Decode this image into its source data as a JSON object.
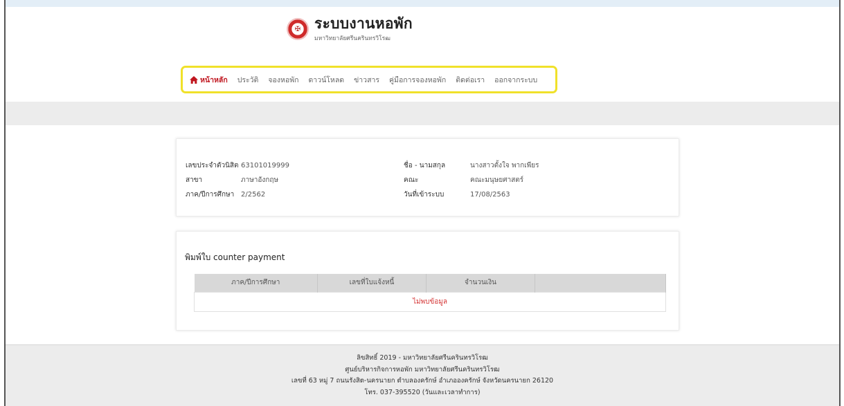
{
  "brand": {
    "seal_glyph": "✠",
    "title": "ระบบงานหอพัก",
    "subtitle": "มหาวิทยาลัยศรีนครินทรวิโรฒ"
  },
  "nav": {
    "items": [
      {
        "label": "หน้าหลัก",
        "active": true,
        "icon": "home-icon"
      },
      {
        "label": "ประวัติ"
      },
      {
        "label": "จองหอพัก"
      },
      {
        "label": "ดาวน์โหลด"
      },
      {
        "label": "ข่าวสาร"
      },
      {
        "label": "คู่มือการจองหอพัก"
      },
      {
        "label": "ติดต่อเรา"
      },
      {
        "label": "ออกจากระบบ"
      }
    ],
    "highlight_color": "#f0e12a",
    "active_color": "#c0161f"
  },
  "profile": {
    "student_id_label": "เลขประจำตัวนิสิต",
    "student_id": "63101019999",
    "name_label": "ชื่อ - นามสกุล",
    "name": "นางสาวตั้งใจ พากเพียร",
    "major_label": "สาขา",
    "major": "ภาษาอังกฤษ",
    "faculty_label": "คณะ",
    "faculty": "คณะมนุษยศาสตร์",
    "term_label": "ภาค/ปีการศึกษา",
    "term": "2/2562",
    "login_date_label": "วันที่เข้าระบบ",
    "login_date": "17/08/2563"
  },
  "payment": {
    "title": "พิมพ์ใบ counter payment",
    "columns": [
      "ภาค/ปีการศึกษา",
      "เลขที่ใบแจ้งหนี้",
      "จำนวนเงิน",
      ""
    ],
    "empty_text": "ไม่พบข้อมูล"
  },
  "footer": {
    "line1": "ลิขสิทธิ์ 2019 - มหาวิทยาลัยศรีนครินทรวิโรฒ",
    "line2": "ศูนย์บริหารกิจการหอพัก มหาวิทยาลัยศรีนครินทรวิโรฒ",
    "line3": "เลขที่ 63 หมู่ 7 ถนนรังสิต-นครนายก ตำบลองครักษ์ อำเภอองครักษ์ จังหวัดนครนายก 26120",
    "line4": "โทร. 037-395520 (วันและเวลาทำการ)"
  }
}
